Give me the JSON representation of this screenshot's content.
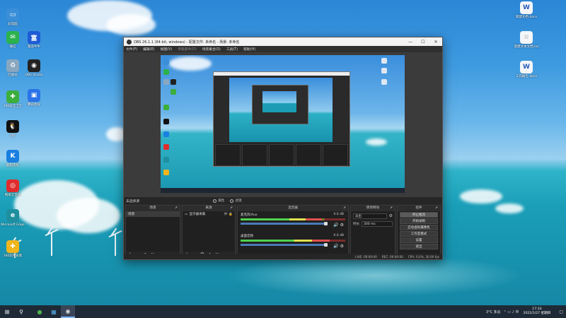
{
  "desktop": {
    "left_icons": [
      {
        "label": "此电脑",
        "color": "#3b8fd9",
        "glyph": "▭"
      },
      {
        "label": "微信",
        "color": "#2bb24c",
        "glyph": "✉"
      },
      {
        "label": "回收站",
        "color": "#8aa7c0",
        "glyph": "♻"
      },
      {
        "label": "OBS Studio",
        "color": "#222222",
        "glyph": "◉"
      },
      {
        "label": "360安全卫士",
        "color": "#3cae3c",
        "glyph": "✚"
      },
      {
        "label": "QQ",
        "color": "#111111",
        "glyph": "🐧"
      },
      {
        "label": "酷狗音乐",
        "color": "#1a7fe0",
        "glyph": "K"
      },
      {
        "label": "网易云音乐",
        "color": "#e02c2c",
        "glyph": "◎"
      },
      {
        "label": "Microsoft Edge",
        "color": "#1f8f9e",
        "glyph": "e"
      },
      {
        "label": "360软件管家",
        "color": "#f2b51c",
        "glyph": "✚"
      }
    ],
    "col2_icons": [
      {
        "label": "富途牛牛",
        "color": "#1e5bd6",
        "glyph": "富"
      },
      {
        "label": "腾讯会议",
        "color": "#2a73e8",
        "glyph": "▣"
      }
    ],
    "right_icons": [
      {
        "label": "新建文档.docx",
        "color": "#2b5cb8",
        "glyph": "W"
      },
      {
        "label": "新建文本文档.txt",
        "color": "#cccccc",
        "glyph": "≡"
      },
      {
        "label": "工作报告.docx",
        "color": "#2b5cb8",
        "glyph": "W"
      }
    ]
  },
  "obs": {
    "title": "OBS 26.1.1 (64-bit, windows) - 配置文件: 未命名 - 场景: 未命名",
    "window_buttons": [
      "—",
      "☐",
      "✕"
    ],
    "menu": [
      "文件(F)",
      "编辑(E)",
      "视图(V)",
      "停靠部件(D)",
      "场景集合(S)",
      "工具(T)",
      "帮助(H)"
    ],
    "menu_dim_index": 3,
    "no_source": "未选择源",
    "properties_label": "属性",
    "filters_label": "滤镜",
    "panels": {
      "scenes": {
        "title": "场景",
        "items": [
          "场景"
        ]
      },
      "sources": {
        "title": "来源",
        "items": [
          {
            "name": "显示器采集",
            "tag": "👁 🔒"
          }
        ]
      },
      "mixer": {
        "title": "混音器",
        "channels": [
          {
            "name": "麦克风/Aux",
            "db": "0.0 dB",
            "level": 0.78
          },
          {
            "name": "桌面音频",
            "db": "0.0 dB",
            "level": 0.85
          }
        ]
      },
      "transitions": {
        "title": "转场特效",
        "type": "淡出",
        "duration_label": "时长",
        "duration": "300 ms"
      },
      "controls": {
        "title": "控件",
        "buttons": [
          "停止推流",
          "开始录制",
          "启动虚拟摄像机",
          "工作室模式",
          "设置",
          "退出"
        ],
        "highlight_index": 0
      }
    },
    "footer_glyphs": [
      "+",
      "−",
      "∧",
      "∨"
    ],
    "footer_glyphs_src": [
      "+",
      "−",
      "⚙",
      "∧",
      "∨"
    ],
    "status": [
      "LIVE: 00:00:00",
      "REC: 00:00:00",
      "CPU: 0.0%, 30.00 fps"
    ]
  },
  "taskbar": {
    "start": "⊞",
    "search": "⚲",
    "apps": [
      {
        "glyph": "●",
        "color": "#4fb24f",
        "active": false
      },
      {
        "glyph": "▦",
        "color": "#58b0e8",
        "active": false
      },
      {
        "glyph": "◉",
        "color": "#dddddd",
        "active": true
      }
    ],
    "weather": "3°C 多云",
    "tray_icons": "⌃ ▭ ♪ 中",
    "time": "17:33",
    "date": "2022/1/27 星期四"
  }
}
